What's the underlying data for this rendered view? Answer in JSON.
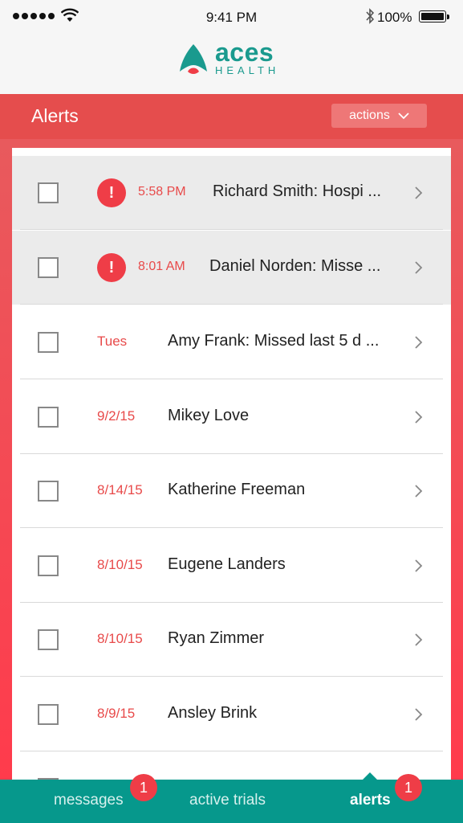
{
  "status_bar": {
    "time": "9:41 PM",
    "battery": "100%"
  },
  "logo": {
    "word": "aces",
    "subtitle": "HEALTH"
  },
  "header": {
    "title": "Alerts",
    "actions_label": "actions"
  },
  "alerts": [
    {
      "date": "5:58 PM",
      "name": "Richard Smith: Hospi ...",
      "urgent": true
    },
    {
      "date": "8:01 AM",
      "name": "Daniel Norden: Misse ...",
      "urgent": true
    },
    {
      "date": "Tues",
      "name": "Amy Frank: Missed last 5 d ...",
      "urgent": false
    },
    {
      "date": "9/2/15",
      "name": "Mikey Love",
      "urgent": false
    },
    {
      "date": "8/14/15",
      "name": "Katherine Freeman",
      "urgent": false
    },
    {
      "date": "8/10/15",
      "name": "Eugene Landers",
      "urgent": false
    },
    {
      "date": "8/10/15",
      "name": "Ryan Zimmer",
      "urgent": false
    },
    {
      "date": "8/9/15",
      "name": "Ansley Brink",
      "urgent": false
    }
  ],
  "alert_icon_glyph": "!",
  "tabs": [
    {
      "label": "messages",
      "badge": "1",
      "active": false
    },
    {
      "label": "active trials",
      "active": false
    },
    {
      "label": "alerts",
      "badge": "1",
      "active": true
    }
  ],
  "colors": {
    "brand_teal": "#06988c",
    "alert_red": "#e54d4d",
    "date_red": "#e84a4a"
  }
}
